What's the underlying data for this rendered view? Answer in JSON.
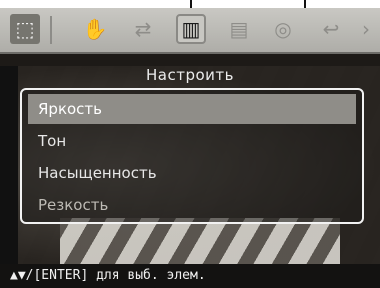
{
  "toolbar": {
    "icons": [
      {
        "name": "edit-select-icon",
        "glyph": "⬚"
      },
      {
        "name": "hand-icon",
        "glyph": "✋"
      },
      {
        "name": "rotate-icon",
        "glyph": "⇄"
      },
      {
        "name": "adjust-icon",
        "glyph": "▥"
      },
      {
        "name": "frame-icon",
        "glyph": "▤"
      },
      {
        "name": "redeye-icon",
        "glyph": "◎"
      },
      {
        "name": "undo-icon",
        "glyph": "↩"
      },
      {
        "name": "next-icon",
        "glyph": "›"
      }
    ]
  },
  "menu": {
    "title": "Настроить",
    "items": [
      {
        "label": "Яркость"
      },
      {
        "label": "Тон"
      },
      {
        "label": "Насыщенность"
      },
      {
        "label": "Резкость"
      }
    ]
  },
  "status": {
    "hint": "▲▼/[ENTER] для выб. элем."
  },
  "colors": {
    "highlight": "#8f8d88",
    "toolbar": "#bdbcb7",
    "statusbar": "#131211"
  }
}
